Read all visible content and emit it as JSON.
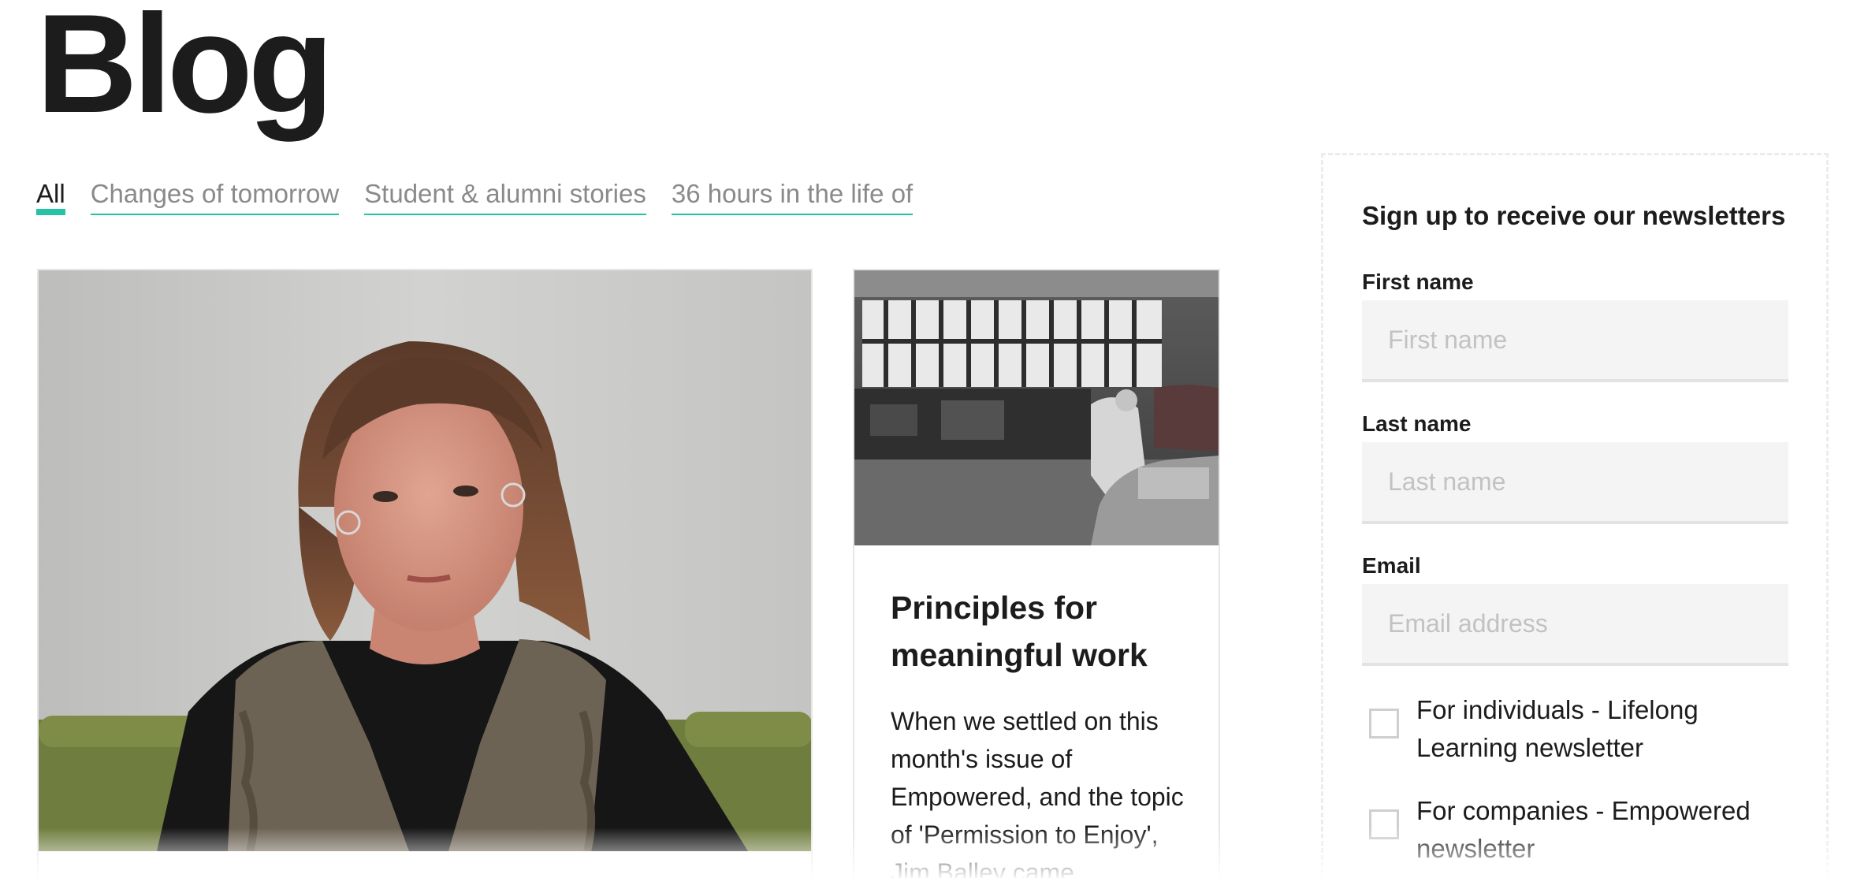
{
  "page": {
    "title": "Blog"
  },
  "tabs": [
    {
      "label": "All",
      "active": true
    },
    {
      "label": "Changes of tomorrow",
      "active": false
    },
    {
      "label": "Student & alumni stories",
      "active": false
    },
    {
      "label": "36 hours in the life of",
      "active": false
    }
  ],
  "featured_card": {
    "image": "portrait-photo"
  },
  "article_card": {
    "image": "workshop-photo",
    "title": "Principles for meaningful work",
    "excerpt": "When we settled on this month's issue of Empowered, and the topic of 'Permission to Enjoy', Jim Balley came"
  },
  "newsletter": {
    "heading": "Sign up to receive our newsletters",
    "first_name": {
      "label": "First name",
      "placeholder": "First name",
      "value": ""
    },
    "last_name": {
      "label": "Last name",
      "placeholder": "Last name",
      "value": ""
    },
    "email": {
      "label": "Email",
      "placeholder": "Email address",
      "value": ""
    },
    "options": [
      {
        "label": "For individuals - Lifelong Learning newsletter",
        "checked": false
      },
      {
        "label": "For companies - Empowered newsletter",
        "checked": false
      }
    ]
  },
  "colors": {
    "accent": "#26c2a4",
    "text": "#1c1c1c",
    "muted_text": "#8a8a8a",
    "input_bg": "#f4f4f4"
  }
}
